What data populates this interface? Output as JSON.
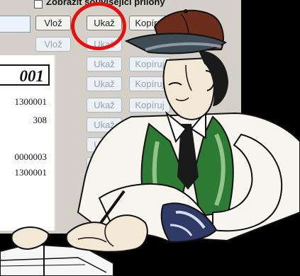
{
  "dialog": {
    "checkbox_label": "Zobrazit související přílohy",
    "input_value": ""
  },
  "buttons": {
    "vloz": "Vlož",
    "ukaz": "Ukaž",
    "kopiruj": "Kopíruj"
  },
  "document": {
    "title": "001",
    "values": [
      "1300001",
      "308",
      "0000003",
      "1300001"
    ]
  },
  "colors": {
    "highlight_circle": "#e3110f",
    "vest_green": "#1f6b2a",
    "cap_brown": "#6b2e1c"
  }
}
